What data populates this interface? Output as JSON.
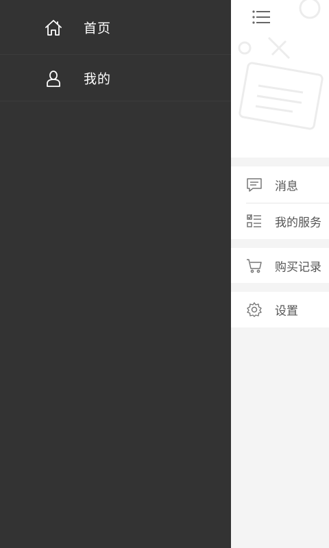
{
  "drawer": {
    "items": [
      {
        "label": "首页",
        "icon": "home-icon"
      },
      {
        "label": "我的",
        "icon": "user-icon"
      }
    ]
  },
  "main": {
    "header": {
      "menu_icon": "menu-icon"
    },
    "groups": [
      {
        "items": [
          {
            "label": "消息",
            "icon": "message-icon"
          },
          {
            "label": "我的服务",
            "icon": "service-list-icon"
          }
        ]
      },
      {
        "items": [
          {
            "label": "购买记录",
            "icon": "cart-icon"
          }
        ]
      },
      {
        "items": [
          {
            "label": "设置",
            "icon": "gear-icon"
          }
        ]
      }
    ]
  },
  "colors": {
    "drawer_bg": "#333333",
    "drawer_text": "#ffffff",
    "main_bg": "#f4f4f4",
    "row_text": "#555555"
  }
}
